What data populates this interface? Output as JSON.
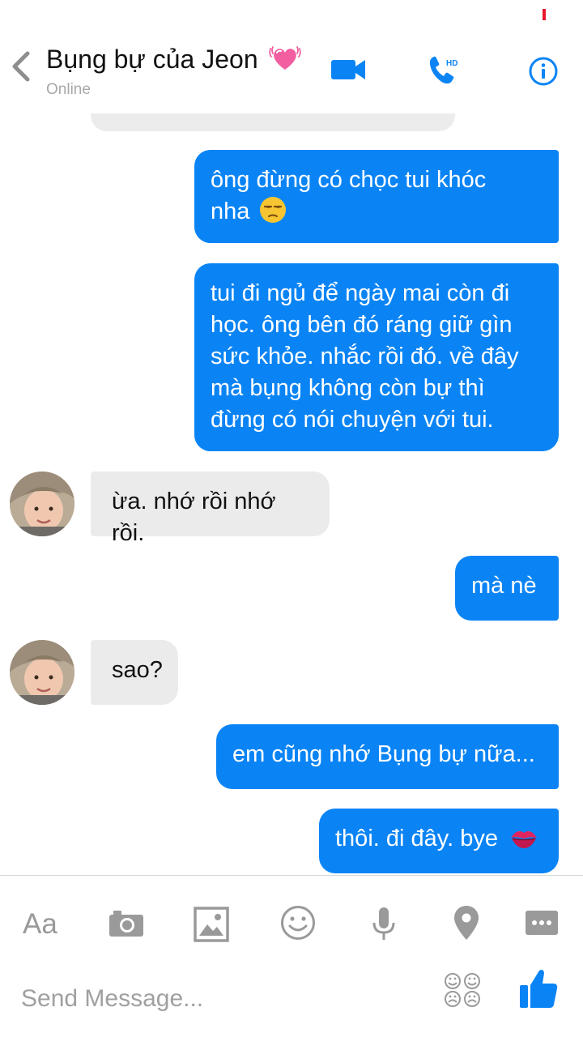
{
  "header": {
    "title": "Bụng bự của Jeon",
    "title_emoji": "heart-emoji",
    "status": "Online",
    "icons": [
      "back-chevron-icon",
      "video-camera-icon",
      "hd-phone-icon",
      "info-icon"
    ],
    "phone_badge": "HD"
  },
  "messages": [
    {
      "from": "me",
      "lines": [
        "ông đừng có chọc tui khóc",
        "nha"
      ],
      "emoji": "unamused-face-emoji"
    },
    {
      "from": "me",
      "lines": [
        "tui đi ngủ để ngày mai còn đi",
        "học. ông bên đó ráng giữ gìn",
        "sức khỏe. nhắc rồi đó. về đây",
        "mà bụng không còn bự thì",
        "đừng có nói chuyện với tui."
      ]
    },
    {
      "from": "them",
      "lines": [
        "ừa. nhớ rồi nhớ rồi."
      ]
    },
    {
      "from": "me",
      "lines": [
        "mà nè"
      ]
    },
    {
      "from": "them",
      "lines": [
        "sao?"
      ]
    },
    {
      "from": "me",
      "lines": [
        "em cũng nhớ Bụng bự nữa..."
      ]
    },
    {
      "from": "me",
      "lines": [
        "thôi. đi đây. bye"
      ],
      "emoji": "kiss-mark-emoji"
    }
  ],
  "toolbar": {
    "aa_label": "Aa",
    "icons": [
      "text-format-icon",
      "camera-icon",
      "image-icon",
      "emoji-icon",
      "microphone-icon",
      "location-pin-icon",
      "more-icon"
    ]
  },
  "composer": {
    "placeholder": "Send Message...",
    "icons": [
      "sticker-faces-icon",
      "thumbs-up-icon"
    ]
  },
  "colors": {
    "accent": "#0a84f5",
    "incoming": "#ebebeb",
    "icon_gray": "#9a9a9a"
  }
}
